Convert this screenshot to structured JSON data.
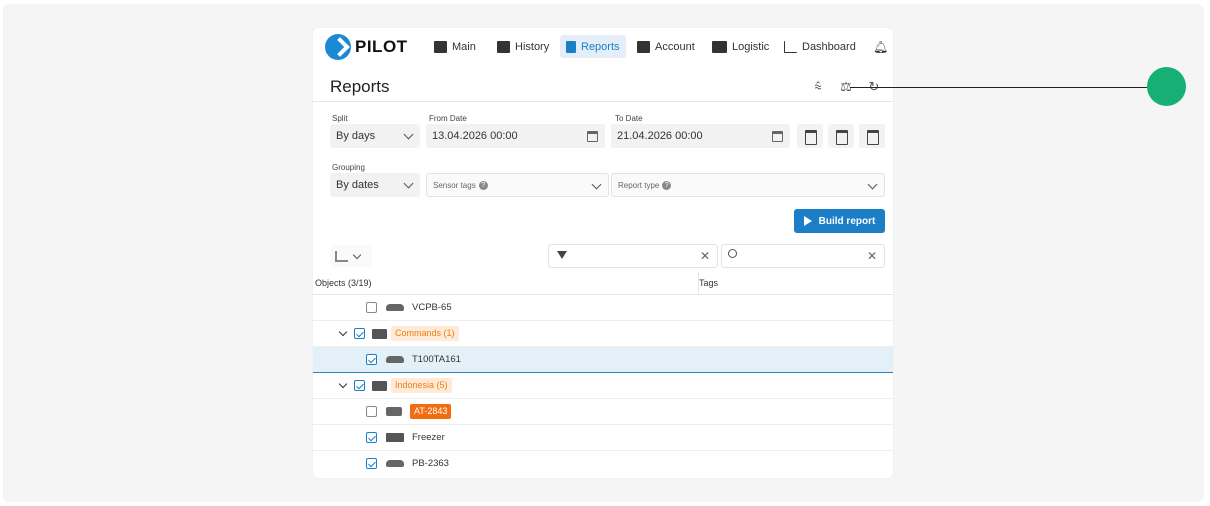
{
  "brand": {
    "logo_text": "PILOT",
    "accent": "#1a7fc7",
    "orange": "#f07d14"
  },
  "nav": {
    "items": [
      {
        "label": "Main",
        "icon": "home-icon"
      },
      {
        "label": "History",
        "icon": "history-icon"
      },
      {
        "label": "Reports",
        "icon": "report-icon",
        "active": true
      },
      {
        "label": "Account",
        "icon": "wallet-icon"
      },
      {
        "label": "Logistic",
        "icon": "truck-icon"
      },
      {
        "label": "Dashboard",
        "icon": "dashboard-icon"
      }
    ],
    "bell_icon": "bell-icon"
  },
  "page": {
    "title": "Reports"
  },
  "form": {
    "split": {
      "label": "Split",
      "value": "By days"
    },
    "from_date": {
      "label": "From Date",
      "value": "13.04.2026 00:00"
    },
    "to_date": {
      "label": "To Date",
      "value": "21.04.2026 00:00"
    },
    "grouping": {
      "label": "Grouping",
      "value": "By dates"
    },
    "sensor_tags": {
      "placeholder": "Sensor tags"
    },
    "report_type": {
      "placeholder": "Report type"
    },
    "build_label": "Build report"
  },
  "table": {
    "col_objects": "Objects (3/19)",
    "col_tags": "Tags",
    "rows": [
      {
        "type": "object",
        "name": "VCPB-65",
        "checked": false
      },
      {
        "type": "group",
        "name": "Commands (1)",
        "checked": true
      },
      {
        "type": "object",
        "name": "T100TA161",
        "checked": true,
        "selected": true
      },
      {
        "type": "group",
        "name": "Indonesia (5)",
        "checked": true
      },
      {
        "type": "object",
        "name": "AT-2843",
        "checked": false,
        "highlight": true
      },
      {
        "type": "object",
        "name": "Freezer",
        "checked": true
      },
      {
        "type": "object",
        "name": "PB-2363",
        "checked": true
      }
    ]
  }
}
